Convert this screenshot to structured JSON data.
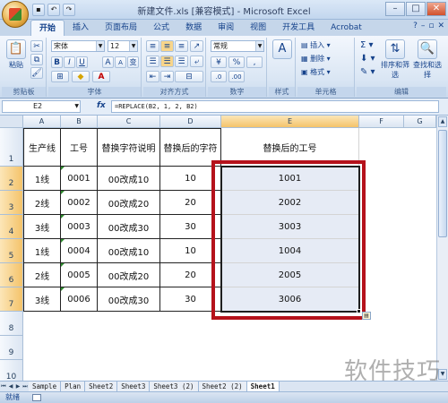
{
  "titlebar": {
    "title": "新建文件.xls [兼容模式] - Microsoft Excel",
    "min": "–",
    "max": "□",
    "close": "✕",
    "qat": [
      "save-icon",
      "undo-icon",
      "redo-icon"
    ]
  },
  "tabs": [
    "开始",
    "插入",
    "页面布局",
    "公式",
    "数据",
    "审阅",
    "视图",
    "开发工具",
    "Acrobat"
  ],
  "ribbon": {
    "clipboard": {
      "label": "剪贴板",
      "paste": "粘贴"
    },
    "font": {
      "label": "字体",
      "name": "宋体",
      "size": "12",
      "bold": "B",
      "italic": "I",
      "underline": "U",
      "grow": "A",
      "shrink": "A",
      "phonetic": "变"
    },
    "alignment": {
      "label": "对齐方式"
    },
    "number": {
      "label": "数字",
      "format": "常规",
      "percent": "%",
      "comma": ",",
      "currency": "¥"
    },
    "styles": {
      "label": "样式"
    },
    "cells": {
      "label": "单元格",
      "insert": "插入",
      "delete": "删除",
      "format": "格式"
    },
    "editing": {
      "label": "编辑",
      "sort": "排序和筛选",
      "find": "查找和选择"
    },
    "colors": {
      "accent": "#15428b",
      "highlight": "#b5121b"
    }
  },
  "formula_bar": {
    "name_box": "E2",
    "fx": "fx",
    "formula": "=REPLACE(B2, 1, 2, B2)"
  },
  "columns": [
    "A",
    "B",
    "C",
    "D",
    "E",
    "F",
    "G"
  ],
  "rows": [
    "1",
    "2",
    "3",
    "4",
    "5",
    "6",
    "7",
    "8",
    "9",
    "10"
  ],
  "table": {
    "headers": [
      "生产线",
      "工号",
      "替换字符说明",
      "替换后的字符",
      "替换后的工号"
    ],
    "data": [
      [
        "1线",
        "0001",
        "00改成10",
        "10",
        "1001"
      ],
      [
        "2线",
        "0002",
        "00改成20",
        "20",
        "2002"
      ],
      [
        "3线",
        "0003",
        "00改成30",
        "30",
        "3003"
      ],
      [
        "1线",
        "0004",
        "00改成10",
        "10",
        "1004"
      ],
      [
        "2线",
        "0005",
        "00改成20",
        "20",
        "2005"
      ],
      [
        "3线",
        "0006",
        "00改成30",
        "30",
        "3006"
      ]
    ]
  },
  "sheet_tabs": [
    "Sample",
    "Plan",
    "Sheet2",
    "Sheet3",
    "Sheet3 (2)",
    "Sheet2 (2)",
    "Sheet1"
  ],
  "status": {
    "ready": "就绪"
  },
  "watermark": "软件技巧"
}
